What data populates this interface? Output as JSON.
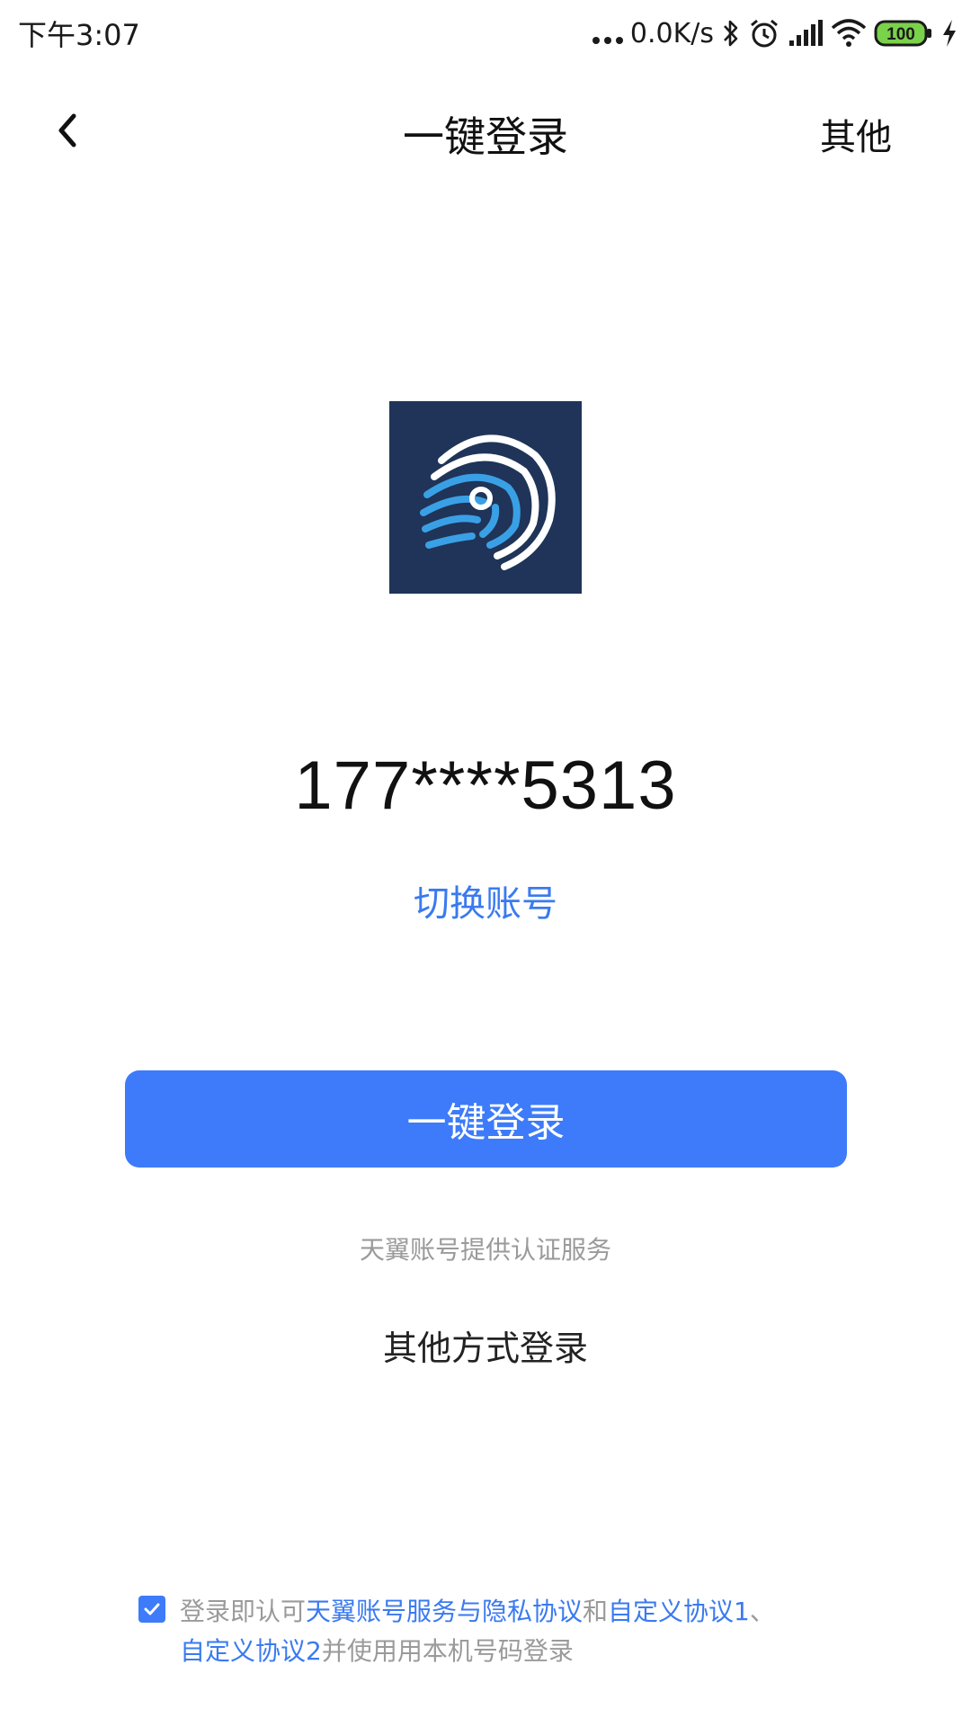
{
  "status_bar": {
    "time": "下午3:07",
    "net_speed": "0.0K/s",
    "battery": "100"
  },
  "header": {
    "title": "一键登录",
    "other": "其他"
  },
  "account": {
    "phone": "177****5313",
    "switch_label": "切换账号"
  },
  "login_button": "一键登录",
  "provider_note": "天翼账号提供认证服务",
  "other_methods": "其他方式登录",
  "agreement": {
    "checked": true,
    "prefix": "登录即认可",
    "link1": "天翼账号服务与隐私协议",
    "and": "和",
    "link2": "自定义协议1",
    "sep": "、",
    "link3": "自定义协议2",
    "suffix": "并使用用本机号码登录"
  },
  "colors": {
    "accent": "#3d7bfa",
    "link": "#3a7af0",
    "logo_bg": "#1f3458",
    "battery_fill": "#7ad14a"
  },
  "icons": [
    "back-chevron-icon",
    "bluetooth-icon",
    "alarm-icon",
    "signal-icon",
    "wifi-icon",
    "battery-icon",
    "charging-icon",
    "fingerprint-logo",
    "check-icon"
  ]
}
